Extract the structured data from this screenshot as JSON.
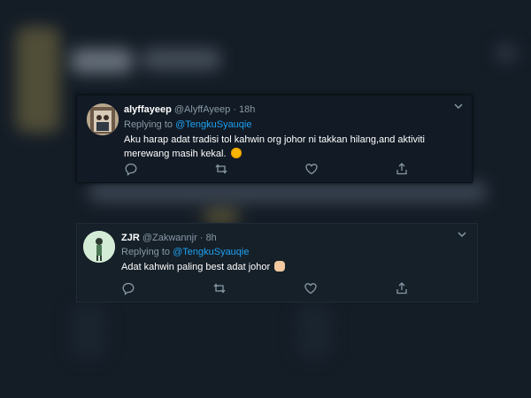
{
  "tweets": [
    {
      "display_name": "alyffayeep",
      "handle": "@AlyffAyeep",
      "separator": "·",
      "time": "18h",
      "replying_prefix": "Replying to ",
      "replying_to": "@TengkuSyauqie",
      "text": "Aku harap adat tradisi tol kahwin org johor ni takkan hilang,and aktiviti merewang masih kekal.",
      "emoji": "smiling-face"
    },
    {
      "display_name": "ZJR",
      "handle": "@Zakwannjr",
      "separator": "·",
      "time": "8h",
      "replying_prefix": "Replying to ",
      "replying_to": "@TengkuSyauqie",
      "text": "Adat kahwin paling best adat johor",
      "emoji": "clapping-hands"
    }
  ],
  "icons": {
    "reply": "reply-icon",
    "retweet": "retweet-icon",
    "like": "heart-icon",
    "share": "share-icon",
    "more": "chevron-down-icon"
  },
  "colors": {
    "background": "#15202b",
    "text_primary": "#ffffff",
    "text_secondary": "#8899a6",
    "mention": "#1da1f2"
  }
}
